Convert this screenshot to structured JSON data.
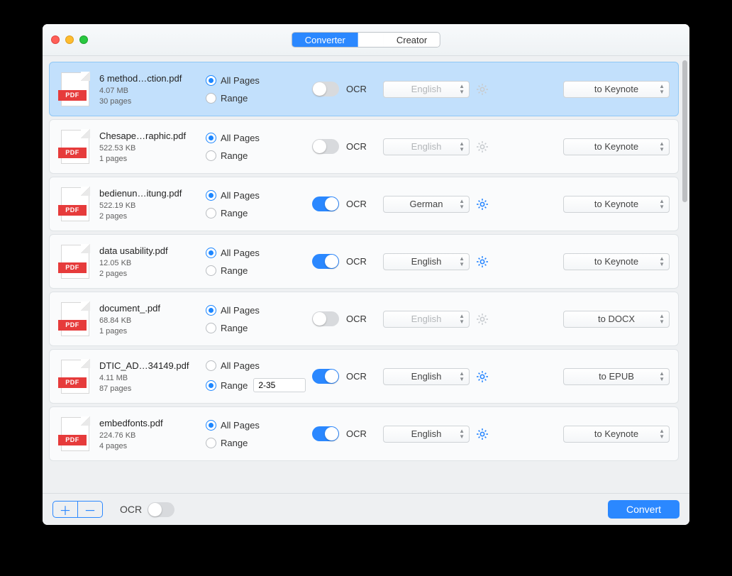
{
  "tabs": {
    "converter": "Converter",
    "creator": "Creator"
  },
  "labels": {
    "allPages": "All Pages",
    "range": "Range",
    "ocr": "OCR",
    "pdfBadge": "PDF"
  },
  "footer": {
    "ocrLabel": "OCR",
    "convert": "Convert"
  },
  "files": [
    {
      "name": "6 method…ction.pdf",
      "size": "4.07 MB",
      "pages": "30 pages",
      "pageMode": "all",
      "rangeText": "",
      "ocr": false,
      "lang": "English",
      "format": "to Keynote",
      "selected": true
    },
    {
      "name": "Chesape…raphic.pdf",
      "size": "522.53 KB",
      "pages": "1 pages",
      "pageMode": "all",
      "rangeText": "",
      "ocr": false,
      "lang": "English",
      "format": "to Keynote",
      "selected": false
    },
    {
      "name": "bedienun…itung.pdf",
      "size": "522.19 KB",
      "pages": "2 pages",
      "pageMode": "all",
      "rangeText": "",
      "ocr": true,
      "lang": "German",
      "format": "to Keynote",
      "selected": false
    },
    {
      "name": "data usability.pdf",
      "size": "12.05 KB",
      "pages": "2 pages",
      "pageMode": "all",
      "rangeText": "",
      "ocr": true,
      "lang": "English",
      "format": "to Keynote",
      "selected": false
    },
    {
      "name": "document_.pdf",
      "size": "68.84 KB",
      "pages": "1 pages",
      "pageMode": "all",
      "rangeText": "",
      "ocr": false,
      "lang": "English",
      "format": "to DOCX",
      "selected": false
    },
    {
      "name": "DTIC_AD…34149.pdf",
      "size": "4.11 MB",
      "pages": "87 pages",
      "pageMode": "range",
      "rangeText": "2-35",
      "ocr": true,
      "lang": "English",
      "format": "to EPUB",
      "selected": false
    },
    {
      "name": "embedfonts.pdf",
      "size": "224.76 KB",
      "pages": "4 pages",
      "pageMode": "all",
      "rangeText": "",
      "ocr": true,
      "lang": "English",
      "format": "to Keynote",
      "selected": false
    }
  ]
}
